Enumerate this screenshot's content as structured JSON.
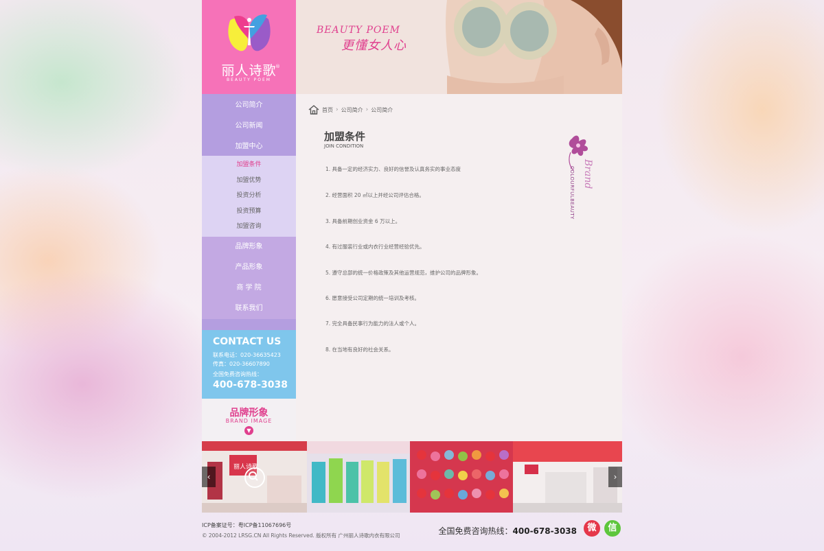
{
  "logo": {
    "cn": "丽人诗歌",
    "en": "BEAUTY POEM",
    "reg": "®"
  },
  "banner": {
    "slogan_en": "BEAUTY POEM",
    "slogan_cn": "更懂女人心"
  },
  "sidebar": {
    "top_items": [
      {
        "label": "公司简介"
      },
      {
        "label": "公司新闻"
      },
      {
        "label": "加盟中心"
      }
    ],
    "sub_items": [
      {
        "label": "加盟条件"
      },
      {
        "label": "加盟优势"
      },
      {
        "label": "投资分析"
      },
      {
        "label": "投资预算"
      },
      {
        "label": "加盟咨询"
      }
    ],
    "bottom_items": [
      {
        "label": "品牌形象"
      },
      {
        "label": "产品形象"
      },
      {
        "label": "商 学 院"
      },
      {
        "label": "联系我们"
      }
    ]
  },
  "contact": {
    "title": "CONTACT US",
    "tel": "联系电话：020-36635423",
    "fax": "传真：020-36607890",
    "hotline_label": "全国免费咨询热线：",
    "hotline": "400-678-3038"
  },
  "brand_box": {
    "cn": "品牌形象",
    "en": "BRAND IMAGE",
    "btn": "▼"
  },
  "breadcrumb": {
    "home": "首页",
    "level1": "公司简介",
    "level2": "公司简介"
  },
  "content": {
    "title": "加盟条件",
    "subtitle": "JOIN CONDITION",
    "conditions": [
      "1. 具备一定的经济实力、良好的信誉及认真务实的事业态度",
      "2. 经营面积 20 ㎡以上并经公司评估合格。",
      "3. 具备前期创业资金 6 万以上。",
      "4. 有过服装行业或内衣行业经营经验优先。",
      "5. 遵守总部的统一价格政策及其他运营规范，维护公司的品牌形象。",
      "6. 愿意接受公司定期的统一培训及考核。",
      "7. 完全具备民事行为能力的法人或个人。",
      "8. 在当地有良好的社会关系。"
    ],
    "deco_text": "COLOURFULBEAUTY",
    "deco_script": "Brand"
  },
  "gallery": {
    "prev": "‹",
    "next": "›"
  },
  "footer": {
    "icp": "ICP备案证号：粤ICP备11067696号",
    "copyright": "© 2004-2012 LRSG.CN All Rights Reserved. 版权所有 广州丽人诗歌内衣有限公司",
    "hotline_label": "全国免费咨询热线：",
    "hotline": "400-678-3038",
    "weibo": "微",
    "wechat": "信"
  },
  "colors": {
    "pink": "#f672b8",
    "accent": "#e0408e",
    "purple": "#b49ee0",
    "lilac": "#ddd3f3",
    "blue": "#7fc6ec"
  }
}
